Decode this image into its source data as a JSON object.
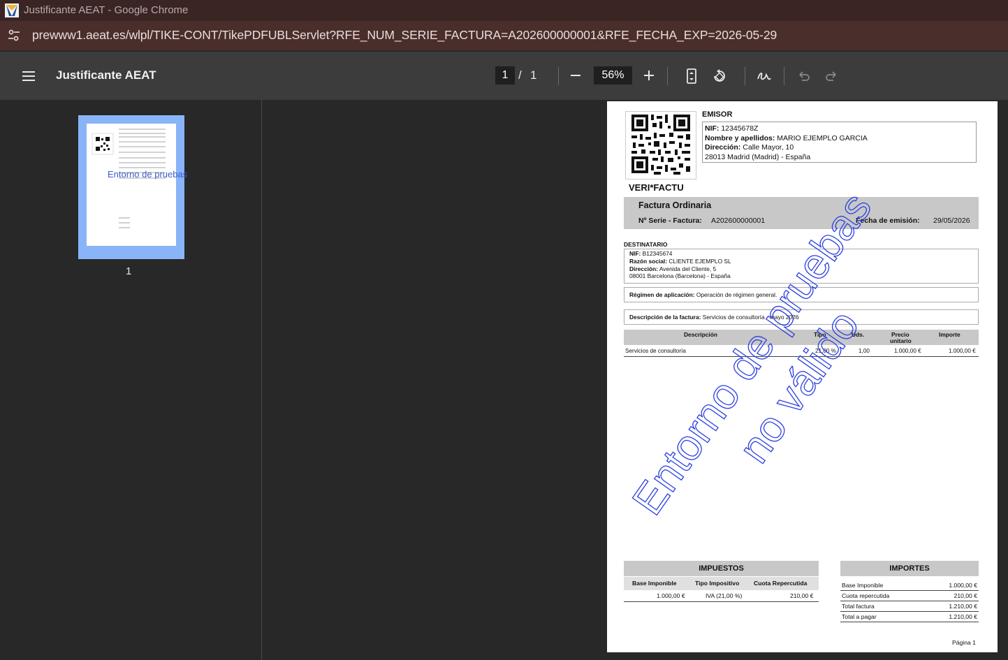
{
  "window": {
    "title": "Justificante AEAT - Google Chrome",
    "url": "prewww1.aeat.es/wlpl/TIKE-CONT/TikePDFUBLServlet?RFE_NUM_SERIE_FACTURA=A202600000001&RFE_FECHA_EXP=2026-05-29"
  },
  "toolbar": {
    "doc_title": "Justificante AEAT",
    "current_page": "1",
    "page_sep": "/",
    "total_pages": "1",
    "zoom": "56%"
  },
  "sidebar": {
    "thumb_watermark": "Entorno de pruebas",
    "thumb_number": "1"
  },
  "document": {
    "emisor_heading": "EMISOR",
    "emisor": {
      "nif_label": "NIF:",
      "nif": "12345678Z",
      "nombre_label": "Nombre y apellidos:",
      "nombre": "MARIO EJEMPLO GARCIA",
      "direccion_label": "Dirección:",
      "direccion": "Calle Mayor, 10",
      "localidad": "28013 Madrid (Madrid) - España"
    },
    "verifactu": "VERI*FACTU",
    "factura_tipo": "Factura Ordinaria",
    "serie_label": "Nº Serie - Factura:",
    "serie": "A202600000001",
    "fecha_label": "Fecha de emisión:",
    "fecha": "29/05/2026",
    "destinatario_heading": "DESTINATARIO",
    "destinatario": {
      "nif_label": "NIF:",
      "nif": "B12345674",
      "razon_label": "Razón social:",
      "razon": "CLIENTE EJEMPLO SL",
      "direccion_label": "Dirección:",
      "direccion": "Avenida del Cliente, 5",
      "localidad": "08001 Barcelona (Barcelona) - España"
    },
    "regimen_label": "Régimen de aplicación:",
    "regimen": "Operación de régimen general.",
    "descripcion_label": "Descripción de la factura:",
    "descripcion": "Servicios de consultoría - mayo 2026",
    "lines_headers": {
      "descripcion": "Descripción",
      "tipo": "Tipo",
      "uds": "Uds.",
      "precio": "Precio",
      "unitario": "unitario",
      "importe": "Importe"
    },
    "lines": [
      {
        "descripcion": "Servicios de consultoría",
        "tipo": "21,00 %",
        "uds": "1,00",
        "precio": "1.000,00 €",
        "importe": "1.000,00 €"
      }
    ],
    "impuestos": {
      "heading": "IMPUESTOS",
      "headers": {
        "base": "Base Imponible",
        "tipo": "Tipo Impositivo",
        "cuota": "Cuota Repercutida"
      },
      "row": {
        "base": "1.000,00 €",
        "tipo": "IVA (21,00 %)",
        "cuota": "210,00 €"
      }
    },
    "importes": {
      "heading": "IMPORTES",
      "rows": [
        {
          "label": "Base Imponible",
          "value": "1.000,00 €"
        },
        {
          "label": "Cuota repercutida",
          "value": "210,00 €"
        },
        {
          "label": "Total factura",
          "value": "1.210,00 €"
        },
        {
          "label": "Total a pagar",
          "value": "1.210,00 €"
        }
      ]
    },
    "watermark_line1": "Entorno de pruebas",
    "watermark_line2": "no válido",
    "pagina": "Página 1"
  },
  "colors": {
    "titlebar": "#3b2524",
    "addressbar": "#4a2e2c",
    "toolbar": "#3c3c3c",
    "viewer_bg": "#282828",
    "thumb_selected": "#8ab4f8",
    "watermark": "#2c3fe0"
  }
}
